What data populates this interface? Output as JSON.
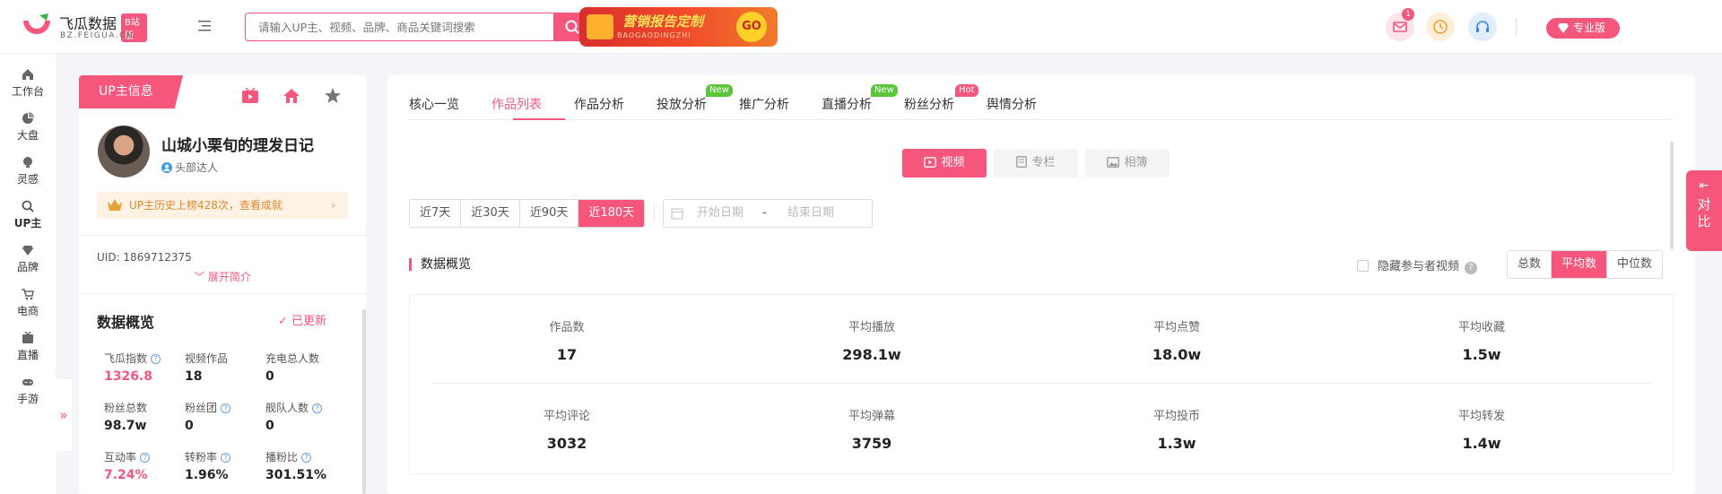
{
  "brand": {
    "name": "飞瓜数据",
    "badge": "B站版",
    "domain": "BZ.FEIGUA.CN",
    "color": "#f7567c"
  },
  "search": {
    "placeholder": "请输入UP主、视频、品牌、商品关键词搜索"
  },
  "banner": {
    "title": "营销报告定制",
    "subtitle": "BAOGAODINGZHI",
    "go": "GO"
  },
  "header": {
    "notification_count": "1",
    "pro_label": "专业版"
  },
  "sidebar": {
    "items": [
      {
        "label": "工作台",
        "icon": "home-icon"
      },
      {
        "label": "大盘",
        "icon": "pie-chart-icon"
      },
      {
        "label": "灵感",
        "icon": "bulb-icon"
      },
      {
        "label": "UP主",
        "icon": "search-icon"
      },
      {
        "label": "品牌",
        "icon": "diamond-icon"
      },
      {
        "label": "电商",
        "icon": "cart-icon"
      },
      {
        "label": "直播",
        "icon": "tv-icon"
      },
      {
        "label": "手游",
        "icon": "gamepad-icon"
      }
    ]
  },
  "up_panel": {
    "tab_label": "UP主信息",
    "name": "山城小栗旬的理发日记",
    "tag": "头部达人",
    "rank_text": "UP主历史上榜428次，查看成就",
    "uid": "UID: 1869712375",
    "expand_label": "展开简介",
    "overview_title": "数据概览",
    "updated_label": "已更新",
    "stats": [
      {
        "label": "飞瓜指数",
        "value": "1326.8",
        "help": true,
        "pink": true
      },
      {
        "label": "视频作品",
        "value": "18",
        "help": false,
        "pink": false
      },
      {
        "label": "充电总人数",
        "value": "0",
        "help": false,
        "pink": false
      },
      {
        "label": "粉丝总数",
        "value": "98.7w",
        "help": false,
        "pink": false
      },
      {
        "label": "粉丝团",
        "value": "0",
        "help": true,
        "pink": false
      },
      {
        "label": "舰队人数",
        "value": "0",
        "help": true,
        "pink": false
      },
      {
        "label": "互动率",
        "value": "7.24%",
        "help": true,
        "pink": true
      },
      {
        "label": "转粉率",
        "value": "1.96%",
        "help": true,
        "pink": false
      },
      {
        "label": "播粉比",
        "value": "301.51%",
        "help": true,
        "pink": false
      }
    ]
  },
  "tabs": [
    {
      "label": "核心一览",
      "active": false,
      "pill": ""
    },
    {
      "label": "作品列表",
      "active": true,
      "pill": ""
    },
    {
      "label": "作品分析",
      "active": false,
      "pill": ""
    },
    {
      "label": "投放分析",
      "active": false,
      "pill": "New"
    },
    {
      "label": "推广分析",
      "active": false,
      "pill": ""
    },
    {
      "label": "直播分析",
      "active": false,
      "pill": "New"
    },
    {
      "label": "粉丝分析",
      "active": false,
      "pill": "Hot"
    },
    {
      "label": "舆情分析",
      "active": false,
      "pill": ""
    }
  ],
  "content_types": [
    {
      "label": "视频",
      "active": true
    },
    {
      "label": "专栏",
      "active": false
    },
    {
      "label": "相簿",
      "active": false
    }
  ],
  "date_ranges": [
    {
      "label": "近7天",
      "active": false
    },
    {
      "label": "近30天",
      "active": false
    },
    {
      "label": "近90天",
      "active": false
    },
    {
      "label": "近180天",
      "active": true
    }
  ],
  "date_picker": {
    "start": "开始日期",
    "sep": "-",
    "end": "结束日期"
  },
  "overview": {
    "title": "数据概览",
    "hide_label": "隐藏参与者视频",
    "modes": [
      {
        "label": "总数",
        "active": false
      },
      {
        "label": "平均数",
        "active": true
      },
      {
        "label": "中位数",
        "active": false
      }
    ],
    "metrics": [
      {
        "label": "作品数",
        "value": "17"
      },
      {
        "label": "平均播放",
        "value": "298.1w"
      },
      {
        "label": "平均点赞",
        "value": "18.0w"
      },
      {
        "label": "平均收藏",
        "value": "1.5w"
      },
      {
        "label": "平均评论",
        "value": "3032"
      },
      {
        "label": "平均弹幕",
        "value": "3759"
      },
      {
        "label": "平均投币",
        "value": "1.3w"
      },
      {
        "label": "平均转发",
        "value": "1.4w"
      }
    ]
  },
  "compare": {
    "label": "对比"
  }
}
